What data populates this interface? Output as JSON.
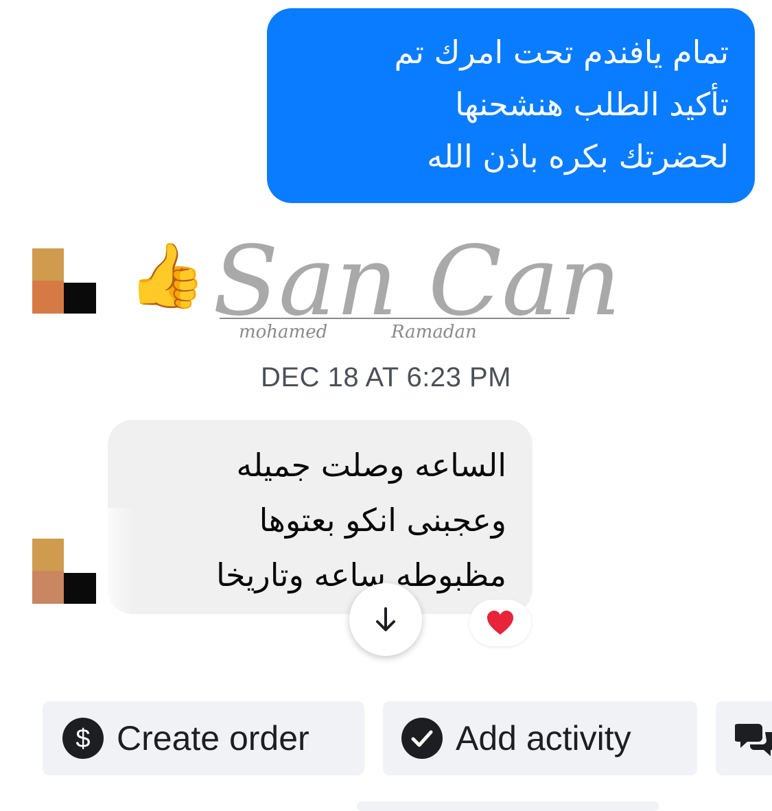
{
  "outgoing_message": {
    "lines": [
      "تمام يافندم تحت امرك تم",
      "تأكيد الطلب هنشحنها",
      "لحضرتك بكره باذن الله"
    ]
  },
  "thumbs_up_reaction": "👍",
  "watermark": {
    "name": "San Can",
    "subtitle_first": "mohamed",
    "subtitle_last": "Ramadan"
  },
  "timestamp": "DEC 18 AT 6:23 PM",
  "incoming_message": {
    "lines": [
      "الساعه وصلت جميله",
      "وعجبنى انكو بعتوها",
      "مظبوطه ساعه وتاريخا"
    ]
  },
  "message_reaction": "heart",
  "actions": {
    "create_order_label": "Create order",
    "add_activity_label": "Add activity"
  },
  "colors": {
    "outgoing_bubble": "#0a7cff",
    "incoming_bubble": "#f0f0f0",
    "chip_background": "#f0f2f5",
    "heart": "#e8243a"
  },
  "icons": [
    "dollar-icon",
    "check-circle-icon",
    "chat-bubbles-icon",
    "arrow-down-icon",
    "heart-icon"
  ]
}
